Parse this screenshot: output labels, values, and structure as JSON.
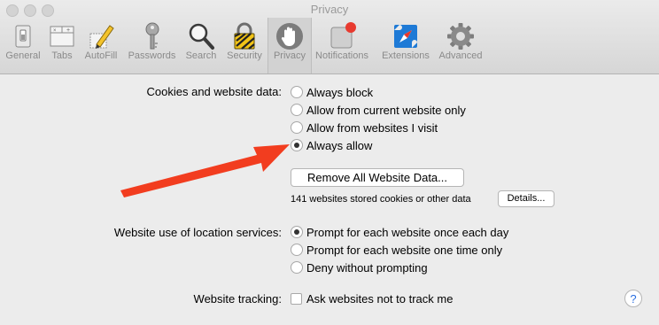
{
  "window": {
    "title": "Privacy"
  },
  "toolbar": {
    "tabs": [
      {
        "label": "General",
        "icon": "general-switch-icon"
      },
      {
        "label": "Tabs",
        "icon": "tabs-icon"
      },
      {
        "label": "AutoFill",
        "icon": "autofill-pencil-icon"
      },
      {
        "label": "Passwords",
        "icon": "key-icon"
      },
      {
        "label": "Search",
        "icon": "magnifier-icon"
      },
      {
        "label": "Security",
        "icon": "lock-icon"
      },
      {
        "label": "Privacy",
        "icon": "hand-icon",
        "selected": true
      },
      {
        "label": "Notifications",
        "icon": "notification-icon"
      },
      {
        "label": "Extensions",
        "icon": "compass-icon"
      },
      {
        "label": "Advanced",
        "icon": "gear-icon"
      }
    ]
  },
  "cookies": {
    "label": "Cookies and website data:",
    "options": [
      "Always block",
      "Allow from current website only",
      "Allow from websites I visit",
      "Always allow"
    ],
    "selected_index": 3,
    "remove_button": "Remove All Website Data...",
    "stored_text": "141 websites stored cookies or other data",
    "details_button": "Details..."
  },
  "location": {
    "label": "Website use of location services:",
    "options": [
      "Prompt for each website once each day",
      "Prompt for each website one time only",
      "Deny without prompting"
    ],
    "selected_index": 0
  },
  "tracking": {
    "label": "Website tracking:",
    "checkbox_label": "Ask websites not to track me",
    "checked": false
  },
  "help": {
    "glyph": "?"
  },
  "colors": {
    "arrow": "#f23d1f",
    "notification_badge": "#e83a2f",
    "selected_tab_bg": "#d2d2d2"
  }
}
